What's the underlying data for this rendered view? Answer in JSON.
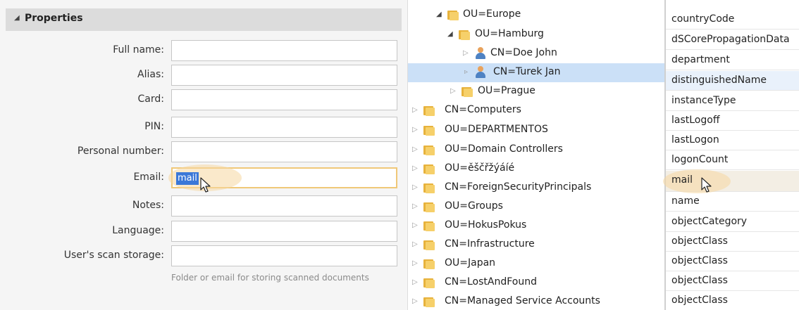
{
  "properties": {
    "title": "Properties",
    "fields": [
      {
        "label": "Full name:",
        "value": ""
      },
      {
        "label": "Alias:",
        "value": ""
      },
      {
        "label": "Card:",
        "value": ""
      },
      {
        "label": "PIN:",
        "value": ""
      },
      {
        "label": "Personal number:",
        "value": ""
      },
      {
        "label": "Email:",
        "value": "mail"
      },
      {
        "label": "Notes:",
        "value": ""
      },
      {
        "label": "Language:",
        "value": ""
      },
      {
        "label": "User's scan storage:",
        "value": ""
      }
    ],
    "hint": "Folder or email for storing scanned documents"
  },
  "tree": {
    "items": [
      {
        "label": "OU=Europe",
        "icon": "folder-icon"
      },
      {
        "label": "OU=Hamburg",
        "icon": "folder-icon"
      },
      {
        "label": "CN=Doe John",
        "icon": "user-icon"
      },
      {
        "label": "CN=Turek Jan",
        "icon": "user-icon"
      },
      {
        "label": "OU=Prague",
        "icon": "folder-icon"
      },
      {
        "label": "CN=Computers",
        "icon": "folder-icon"
      },
      {
        "label": "OU=DEPARTMENTOS",
        "icon": "folder-icon"
      },
      {
        "label": "OU=Domain Controllers",
        "icon": "folder-icon"
      },
      {
        "label": "OU=ěščřžýáíé",
        "icon": "folder-icon"
      },
      {
        "label": "CN=ForeignSecurityPrincipals",
        "icon": "folder-icon"
      },
      {
        "label": "OU=Groups",
        "icon": "folder-icon"
      },
      {
        "label": "OU=HokusPokus",
        "icon": "folder-icon"
      },
      {
        "label": "CN=Infrastructure",
        "icon": "folder-icon"
      },
      {
        "label": "OU=Japan",
        "icon": "folder-icon"
      },
      {
        "label": "CN=LostAndFound",
        "icon": "folder-icon"
      },
      {
        "label": "CN=Managed Service Accounts",
        "icon": "folder-icon"
      }
    ],
    "selected": "CN=Turek Jan"
  },
  "attributes": {
    "items": [
      "countryCode",
      "dSCorePropagationData",
      "department",
      "distinguishedName",
      "instanceType",
      "lastLogoff",
      "lastLogon",
      "logonCount",
      "mail",
      "name",
      "objectCategory",
      "objectClass",
      "objectClass",
      "objectClass",
      "objectClass"
    ],
    "selected": "distinguishedName",
    "hovered": "mail"
  },
  "colors": {
    "selection_blue": "#3b78d8",
    "focus_orange": "#f0c878",
    "tree_selected": "#cbe0f7"
  }
}
